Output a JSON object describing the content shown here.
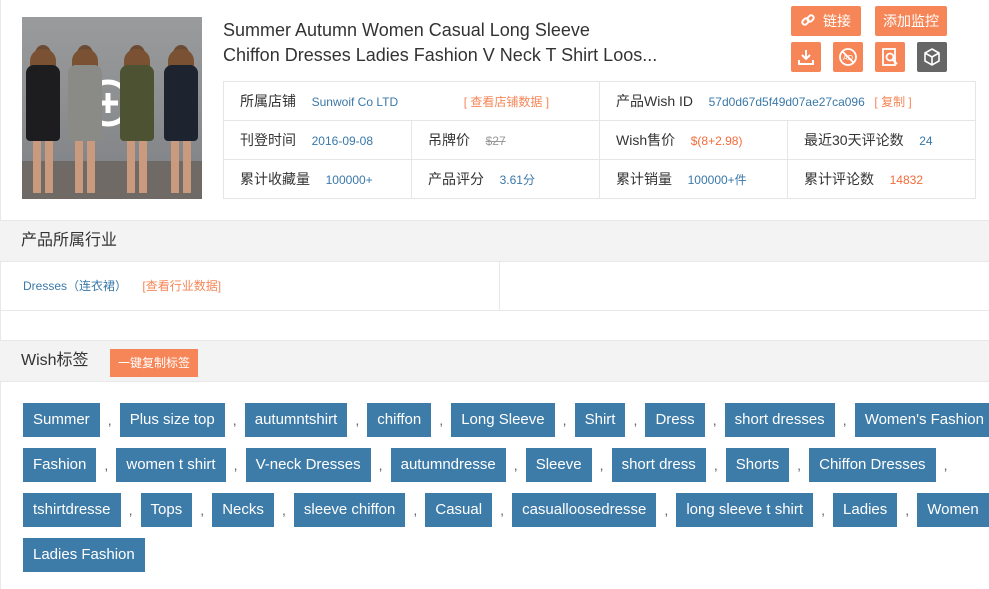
{
  "product": {
    "title_line1": "Summer Autumn Women Casual Long Sleeve",
    "title_line2": "Chiffon Dresses Ladies Fashion V Neck T Shirt Loos..."
  },
  "actions": {
    "link_label": "链接",
    "monitor_label": "添加监控",
    "tools": [
      "download-icon",
      "no-ads-icon",
      "search-doc-icon",
      "cube-icon"
    ]
  },
  "info": {
    "shop_label": "所属店铺",
    "shop_value": "Sunwoif Co LTD",
    "shop_link": "[ 查看店铺数据 ]",
    "wish_id_label": "产品Wish ID",
    "wish_id_value": "57d0d67d5f49d07ae27ca096",
    "copy_label": "[ 复制 ]",
    "listed_label": "刊登时间",
    "listed_value": "2016-09-08",
    "tag_price_label": "吊牌价",
    "tag_price_value": "$27",
    "wish_price_label": "Wish售价",
    "wish_price_value": "$(8+2.98)",
    "reviews30_label": "最近30天评论数",
    "reviews30_value": "24",
    "favorites_label": "累计收藏量",
    "favorites_value": "100000+",
    "rating_label": "产品评分",
    "rating_value": "3.61分",
    "sales_label": "累计销量",
    "sales_value": "100000+件",
    "reviews_label": "累计评论数",
    "reviews_value": "14832"
  },
  "industry": {
    "heading": "产品所属行业",
    "name": "Dresses（连衣裙）",
    "link": "[查看行业数据]"
  },
  "wish_tags": {
    "heading": "Wish标签",
    "copy_button": "一键复制标签",
    "separator": ",",
    "rows": [
      [
        "Summer",
        "Plus size top",
        "autumntshirt",
        "chiffon",
        "Long Sleeve",
        "Shirt",
        "Dress",
        "short dresses",
        "Women's Fashion"
      ],
      [
        "Fashion",
        "women t shirt",
        "V-neck Dresses",
        "autumndresse",
        "Sleeve",
        "short dress",
        "Shorts",
        "Chiffon Dresses"
      ],
      [
        "tshirtdresse",
        "Tops",
        "Necks",
        "sleeve chiffon",
        "Casual",
        "casualloosedresse",
        "long sleeve t shirt",
        "Ladies",
        "Women"
      ],
      [
        "Ladies Fashion"
      ]
    ]
  },
  "colors": {
    "accent_orange": "#f68657",
    "tag_blue": "#3d7ba8",
    "link_blue": "#3a78a8"
  }
}
